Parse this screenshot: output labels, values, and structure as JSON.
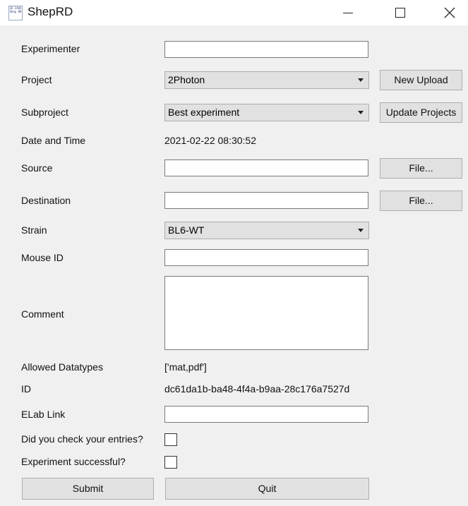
{
  "window": {
    "title": "ShepRD",
    "icon_text": "ID 2405 Shep RD"
  },
  "form": {
    "experimenter": {
      "label": "Experimenter",
      "value": ""
    },
    "project": {
      "label": "Project",
      "value": "2Photon"
    },
    "subproject": {
      "label": "Subproject",
      "value": "Best experiment"
    },
    "datetime": {
      "label": "Date and Time",
      "value": "2021-02-22 08:30:52"
    },
    "source": {
      "label": "Source",
      "value": ""
    },
    "destination": {
      "label": "Destination",
      "value": ""
    },
    "strain": {
      "label": "Strain",
      "value": "BL6-WT"
    },
    "mouse_id": {
      "label": "Mouse ID",
      "value": ""
    },
    "comment": {
      "label": "Comment",
      "value": ""
    },
    "allowed_datatypes": {
      "label": "Allowed Datatypes",
      "value": "['mat,pdf']"
    },
    "id": {
      "label": "ID",
      "value": "dc61da1b-ba48-4f4a-b9aa-28c176a7527d"
    },
    "elab_link": {
      "label": "ELab Link",
      "value": ""
    },
    "check_entries": {
      "label": "Did you check your entries?",
      "checked": false
    },
    "experiment_successful": {
      "label": "Experiment successful?",
      "checked": false
    }
  },
  "buttons": {
    "new_upload": "New Upload",
    "update_projects": "Update Projects",
    "source_file": "File...",
    "destination_file": "File...",
    "submit": "Submit",
    "quit": "Quit"
  }
}
